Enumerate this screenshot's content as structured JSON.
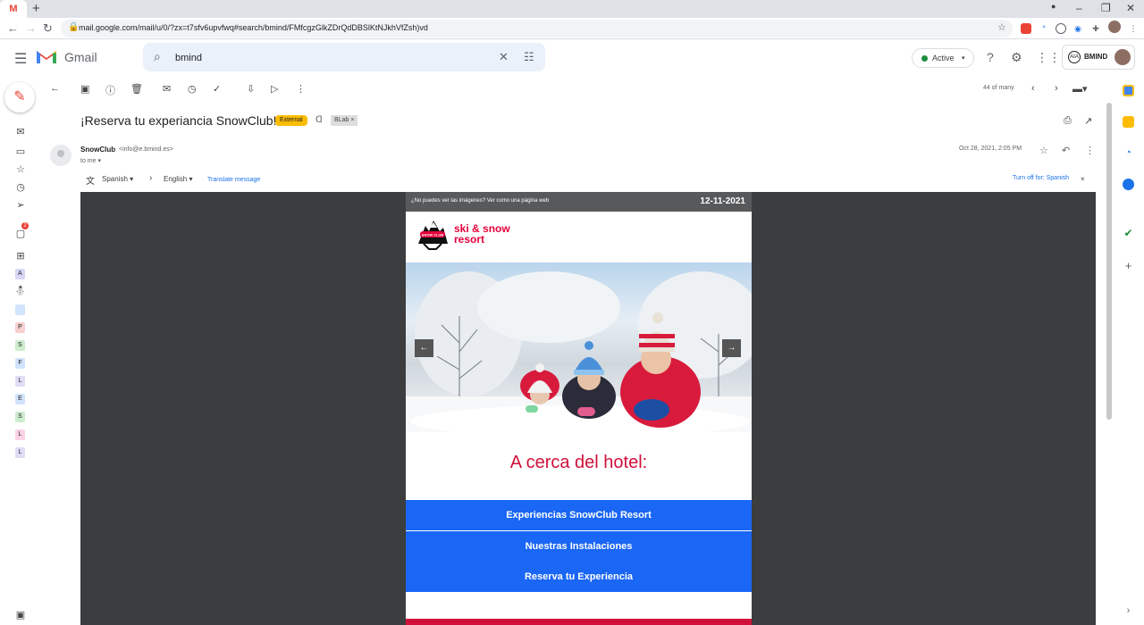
{
  "browser": {
    "url": "mail.google.com/mail/u/0/?zx=t7sfv6upvfwq#search/bmind/FMfcgzGlkZDrQdDBSlKtNJkhVfZsh)vd",
    "tab_icon": "M",
    "new_tab": "+",
    "window_controls": [
      "–",
      "❐",
      "✕"
    ]
  },
  "gmail": {
    "app_name": "Gmail",
    "search_value": "bmind",
    "status": "Active",
    "account": "BMIND",
    "account_logo": "AIA"
  },
  "toolbar": {
    "count": "44 of many"
  },
  "message": {
    "subject": "¡Reserva tu experiancia SnowClub!",
    "external_badge": "External",
    "label": "BLab",
    "label_close": "×",
    "sender_name": "SnowClub",
    "sender_email": "<info@e.bmind.es>",
    "to": "to me",
    "date": "Oct 28, 2021, 2:05 PM"
  },
  "translate": {
    "from": "Spanish",
    "to": "English",
    "action": "Translate message",
    "turn_off": "Turn off for: Spanish",
    "close": "×"
  },
  "email": {
    "preheader": "¿No puedes ver las imágenes? Ver como una página web",
    "date": "12-11-2021",
    "logo_line1": "ski & snow",
    "logo_line2": "resort",
    "logo_badge": "SNOW CLUB",
    "heading": "A cerca del hotel:",
    "buttons": [
      "Experiencias SnowClub Resort",
      "Nuestras Instalaciones",
      "Reserva tu Experiencia"
    ],
    "prev_arrow": "←",
    "next_arrow": "→"
  },
  "rail": {
    "chat_badge": "2",
    "labels": [
      {
        "letter": "A",
        "color": "#d7d7f5"
      },
      {
        "letter": "P",
        "color": "#f8d0d0"
      },
      {
        "letter": "S",
        "color": "#cdeccd"
      },
      {
        "letter": "F",
        "color": "#d2e3fc"
      },
      {
        "letter": "L",
        "color": "#e1dcf5"
      },
      {
        "letter": "E",
        "color": "#d2e3fc"
      },
      {
        "letter": "S",
        "color": "#cdeccd"
      },
      {
        "letter": "L",
        "color": "#fad2e6"
      },
      {
        "letter": "L",
        "color": "#e1dcf5"
      }
    ]
  },
  "colors": {
    "accent": "#1a73e8",
    "brand_red": "#e4003a",
    "cta_blue": "#1a66f5"
  }
}
